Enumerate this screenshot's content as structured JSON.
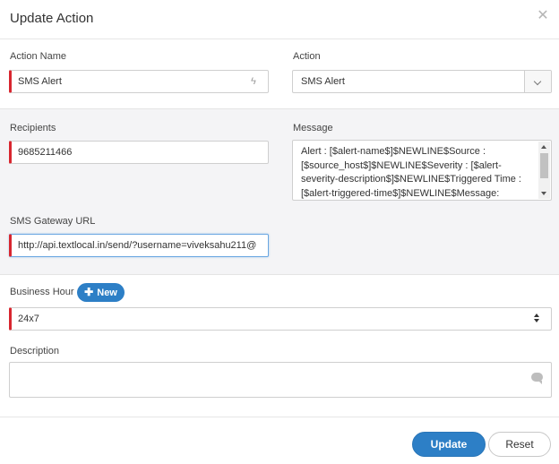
{
  "dialog": {
    "title": "Update Action",
    "close_icon": "close-icon"
  },
  "action_name": {
    "label": "Action Name",
    "value": "SMS Alert",
    "icon": "bolt-icon"
  },
  "action": {
    "label": "Action",
    "value": "SMS Alert"
  },
  "recipients": {
    "label": "Recipients",
    "value": "9685211466"
  },
  "message": {
    "label": "Message",
    "value": "Alert : [$alert-name$]$NEWLINE$Source : [$source_host$]$NEWLINE$Severity : [$alert-severity-description$]$NEWLINE$Triggered Time : [$alert-triggered-time$]$NEWLINE$Message: [$message$]$NEWLINE$Monitor Name : [$monitor-name$]"
  },
  "sms_gateway": {
    "label": "SMS Gateway URL",
    "value": "http://api.textlocal.in/send/?username=viveksahu211@"
  },
  "business_hour": {
    "label": "Business Hour",
    "new_button": "New",
    "value": "24x7"
  },
  "description": {
    "label": "Description",
    "value": "",
    "icon": "comment-icon"
  },
  "footer": {
    "update_label": "Update",
    "reset_label": "Reset"
  },
  "colors": {
    "accent": "#2d7fc6",
    "required_marker": "#d8262f",
    "section_bg": "#f4f4f6"
  }
}
